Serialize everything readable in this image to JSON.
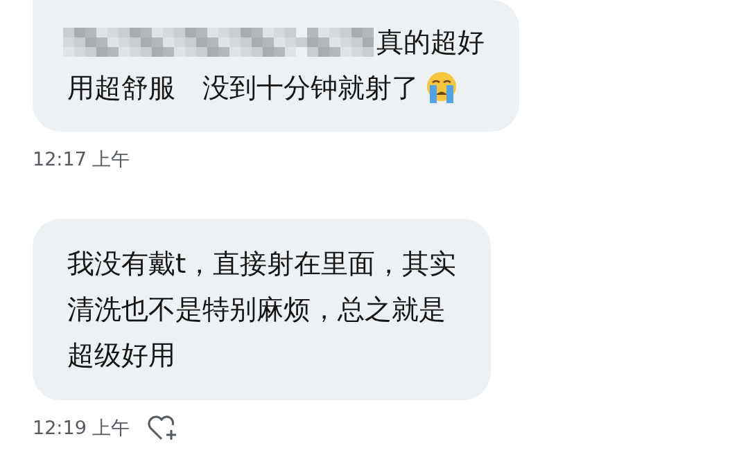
{
  "messages": [
    {
      "lines": [
        "真的超好",
        "用超舒服　没到十分钟就射了"
      ],
      "redacted": true,
      "emoji": true,
      "time": "12:17 上午",
      "reaction_button": false
    },
    {
      "lines": [
        "我没有戴t，直接射在里面，其实",
        "清洗也不是特别麻烦，总之就是",
        "超级好用"
      ],
      "redacted": false,
      "emoji": false,
      "time": "12:19 上午",
      "reaction_button": true
    }
  ]
}
